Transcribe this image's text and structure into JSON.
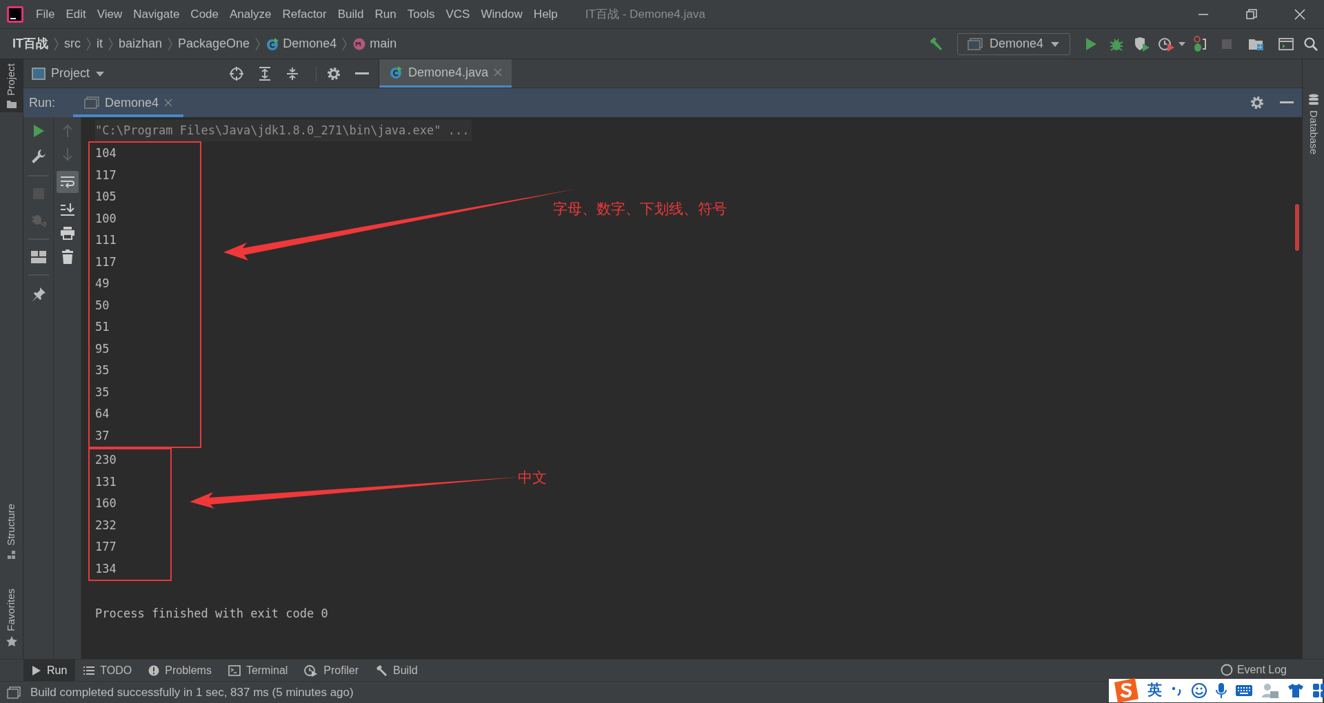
{
  "window": {
    "title": "IT百战 - Demone4.java"
  },
  "menu": [
    "File",
    "Edit",
    "View",
    "Navigate",
    "Code",
    "Analyze",
    "Refactor",
    "Build",
    "Run",
    "Tools",
    "VCS",
    "Window",
    "Help"
  ],
  "breadcrumbs": [
    {
      "label": "IT百战",
      "kind": "project"
    },
    {
      "label": "src",
      "kind": "folder"
    },
    {
      "label": "it",
      "kind": "folder"
    },
    {
      "label": "baizhan",
      "kind": "folder"
    },
    {
      "label": "PackageOne",
      "kind": "folder"
    },
    {
      "label": "Demone4",
      "kind": "class"
    },
    {
      "label": "main",
      "kind": "method"
    }
  ],
  "run_config": "Demone4",
  "project_panel": {
    "title": "Project"
  },
  "editor_tabs": [
    {
      "label": "Demone4.java",
      "selected": true
    }
  ],
  "left_stripe": [
    {
      "label": "Project",
      "selected": true
    },
    {
      "label": "Structure",
      "selected": false
    },
    {
      "label": "Favorites",
      "selected": false
    }
  ],
  "right_stripe": [
    {
      "label": "Database",
      "selected": false
    }
  ],
  "run_panel": {
    "title": "Run:",
    "tabs": [
      {
        "label": "Demone4",
        "selected": true
      }
    ],
    "command": "\"C:\\Program Files\\Java\\jdk1.8.0_271\\bin\\java.exe\" ...",
    "output_groups": [
      {
        "lines": [
          "104",
          "117",
          "105",
          "100",
          "111",
          "117",
          "49",
          "50",
          "51",
          "95",
          "35",
          "35",
          "64",
          "37"
        ],
        "note": "字母、数字、下划线、符号"
      },
      {
        "lines": [
          "230",
          "131",
          "160",
          "232",
          "177",
          "134"
        ],
        "note": "中文"
      }
    ],
    "exit_message": "Process finished with exit code 0"
  },
  "bottom_tabs": [
    {
      "label": "Run",
      "kind": "run",
      "selected": true
    },
    {
      "label": "TODO",
      "kind": "todo",
      "selected": false
    },
    {
      "label": "Problems",
      "kind": "problems",
      "selected": false
    },
    {
      "label": "Terminal",
      "kind": "terminal",
      "selected": false
    },
    {
      "label": "Profiler",
      "kind": "profiler",
      "selected": false
    },
    {
      "label": "Build",
      "kind": "build",
      "selected": false
    }
  ],
  "event_log": "Event Log",
  "status_bar": {
    "message": "Build completed successfully in 1 sec, 837 ms (5 minutes ago)"
  },
  "ime_toolbar": {
    "mode": "英"
  }
}
